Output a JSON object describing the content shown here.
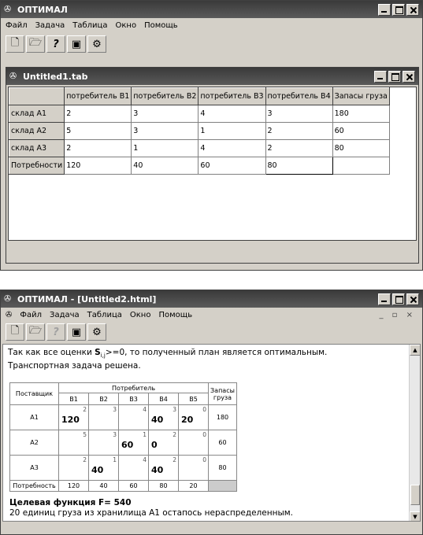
{
  "win1": {
    "title": "ОПТИМАЛ",
    "menu": [
      "Файл",
      "Задача",
      "Таблица",
      "Окно",
      "Помощь"
    ],
    "child_title": "Untitled1.tab",
    "table": {
      "headers": [
        "",
        "потребитель В1",
        "потребитель В2",
        "потребитель В3",
        "потребитель В4",
        "Запасы груза"
      ],
      "rows": [
        [
          "склад А1",
          "2",
          "3",
          "4",
          "3",
          "180"
        ],
        [
          "склад А2",
          "5",
          "3",
          "1",
          "2",
          "60"
        ],
        [
          "склад А3",
          "2",
          "1",
          "4",
          "2",
          "80"
        ],
        [
          "Потребности",
          "120",
          "40",
          "60",
          "80",
          ""
        ]
      ]
    }
  },
  "win2": {
    "title": "ОПТИМАЛ - [Untitled2.html]",
    "menu": [
      "Файл",
      "Задача",
      "Таблица",
      "Окно",
      "Помощь"
    ],
    "msg_prefix": "Так как все оценки ",
    "msg_symbol": "S",
    "msg_sub": "i,j",
    "msg_suffix": ">=0, то полученный план является оптимальным.",
    "msg_line2": "Транспортная задача решена.",
    "result": {
      "supplier_header": "Поставщик",
      "consumer_header": "Потребитель",
      "stock_header": "Запасы груза",
      "consumers": [
        "B1",
        "B2",
        "B3",
        "B4",
        "B5"
      ],
      "rows": [
        {
          "name": "A1",
          "costs": [
            "2",
            "3",
            "4",
            "3",
            "0"
          ],
          "amounts": [
            "120",
            "",
            "",
            "40",
            "20"
          ],
          "stock": "180"
        },
        {
          "name": "A2",
          "costs": [
            "5",
            "3",
            "1",
            "2",
            "0"
          ],
          "amounts": [
            "",
            "",
            "60",
            "0",
            ""
          ],
          "stock": "60"
        },
        {
          "name": "A3",
          "costs": [
            "2",
            "1",
            "4",
            "2",
            "0"
          ],
          "amounts": [
            "",
            "40",
            "",
            "40",
            ""
          ],
          "stock": "80"
        }
      ],
      "demand_label": "Потребность",
      "demand": [
        "120",
        "40",
        "60",
        "80",
        "20"
      ]
    },
    "objective": "Целевая функция F= 540",
    "note": "20 единиц груза из хранилища А1 остапось нераспределенным."
  }
}
